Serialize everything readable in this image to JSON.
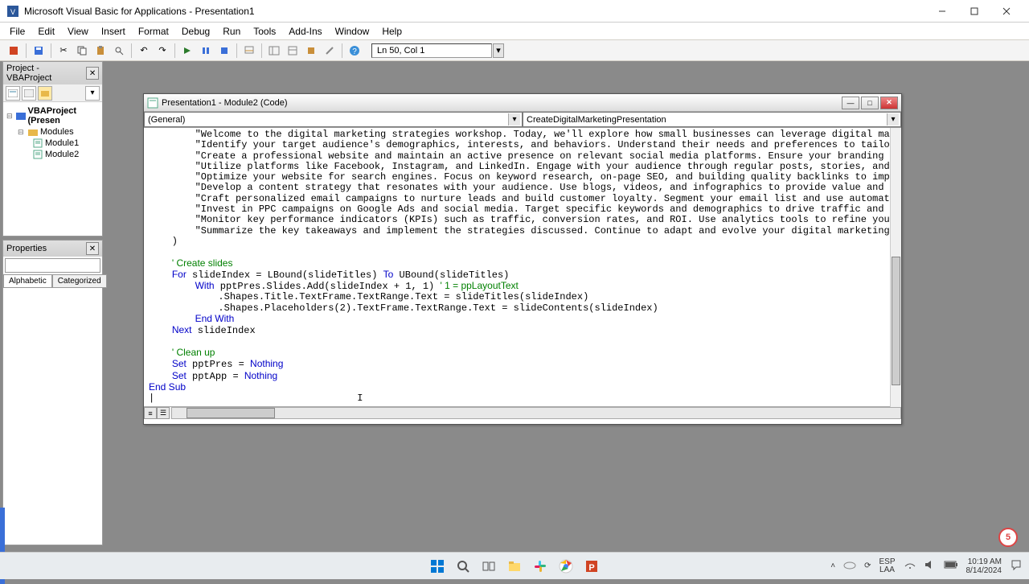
{
  "title": "Microsoft Visual Basic for Applications - Presentation1",
  "menu": [
    "File",
    "Edit",
    "View",
    "Insert",
    "Format",
    "Debug",
    "Run",
    "Tools",
    "Add-Ins",
    "Window",
    "Help"
  ],
  "linecol": "Ln 50, Col 1",
  "project": {
    "title": "Project - VBAProject",
    "root": "VBAProject (Presen",
    "modules_label": "Modules",
    "modules": [
      "Module1",
      "Module2"
    ]
  },
  "properties": {
    "title": "Properties",
    "tabs": [
      "Alphabetic",
      "Categorized"
    ]
  },
  "code_window": {
    "title": "Presentation1 - Module2 (Code)",
    "combo_left": "(General)",
    "combo_right": "CreateDigitalMarketingPresentation"
  },
  "code_lines": [
    {
      "indent": 8,
      "type": "str",
      "text": "\"Welcome to the digital marketing strategies workshop. Today, we'll explore how small businesses can leverage digital marketing"
    },
    {
      "indent": 8,
      "type": "str",
      "text": "\"Identify your target audience's demographics, interests, and behaviors. Understand their needs and preferences to tailor your"
    },
    {
      "indent": 8,
      "type": "str",
      "text": "\"Create a professional website and maintain an active presence on relevant social media platforms. Ensure your branding is cons"
    },
    {
      "indent": 8,
      "type": "str",
      "text": "\"Utilize platforms like Facebook, Instagram, and LinkedIn. Engage with your audience through regular posts, stories, and intera"
    },
    {
      "indent": 8,
      "type": "str",
      "text": "\"Optimize your website for search engines. Focus on keyword research, on-page SEO, and building quality backlinks to improve yo"
    },
    {
      "indent": 8,
      "type": "str",
      "text": "\"Develop a content strategy that resonates with your audience. Use blogs, videos, and infographics to provide value and drive e"
    },
    {
      "indent": 8,
      "type": "str",
      "text": "\"Craft personalized email campaigns to nurture leads and build customer loyalty. Segment your email list and use automation too"
    },
    {
      "indent": 8,
      "type": "str",
      "text": "\"Invest in PPC campaigns on Google Ads and social media. Target specific keywords and demographics to drive traffic and generat"
    },
    {
      "indent": 8,
      "type": "str",
      "text": "\"Monitor key performance indicators (KPIs) such as traffic, conversion rates, and ROI. Use analytics tools to refine your strat"
    },
    {
      "indent": 8,
      "type": "str",
      "text": "\"Summarize the key takeaways and implement the strategies discussed. Continue to adapt and evolve your digital marketing effort"
    },
    {
      "indent": 4,
      "type": "plain",
      "text": ")"
    },
    {
      "indent": 0,
      "type": "blank",
      "text": ""
    },
    {
      "indent": 4,
      "type": "comment",
      "text": "' Create slides"
    },
    {
      "indent": 4,
      "type": "code",
      "segments": [
        {
          "t": "For",
          "k": true
        },
        {
          "t": " slideIndex = "
        },
        {
          "t": "LBound",
          "k": false
        },
        {
          "t": "(slideTitles) "
        },
        {
          "t": "To",
          "k": true
        },
        {
          "t": " "
        },
        {
          "t": "UBound",
          "k": false
        },
        {
          "t": "(slideTitles)"
        }
      ]
    },
    {
      "indent": 8,
      "type": "code",
      "segments": [
        {
          "t": "With",
          "k": true
        },
        {
          "t": " pptPres.Slides.Add(slideIndex + 1, 1) "
        },
        {
          "t": "' 1 = ppLayoutText",
          "c": true
        }
      ]
    },
    {
      "indent": 12,
      "type": "plain",
      "text": ".Shapes.Title.TextFrame.TextRange.Text = slideTitles(slideIndex)"
    },
    {
      "indent": 12,
      "type": "plain",
      "text": ".Shapes.Placeholders(2).TextFrame.TextRange.Text = slideContents(slideIndex)"
    },
    {
      "indent": 8,
      "type": "code",
      "segments": [
        {
          "t": "End With",
          "k": true
        }
      ]
    },
    {
      "indent": 4,
      "type": "code",
      "segments": [
        {
          "t": "Next",
          "k": true
        },
        {
          "t": " slideIndex"
        }
      ]
    },
    {
      "indent": 0,
      "type": "blank",
      "text": ""
    },
    {
      "indent": 4,
      "type": "comment",
      "text": "' Clean up"
    },
    {
      "indent": 4,
      "type": "code",
      "segments": [
        {
          "t": "Set",
          "k": true
        },
        {
          "t": " pptPres = "
        },
        {
          "t": "Nothing",
          "k": true
        }
      ]
    },
    {
      "indent": 4,
      "type": "code",
      "segments": [
        {
          "t": "Set",
          "k": true
        },
        {
          "t": " pptApp = "
        },
        {
          "t": "Nothing",
          "k": true
        }
      ]
    },
    {
      "indent": 0,
      "type": "code",
      "segments": [
        {
          "t": "End Sub",
          "k": true
        }
      ]
    }
  ],
  "systray": {
    "lang1": "ESP",
    "lang2": "LAA",
    "time": "10:19 AM",
    "date": "8/14/2024",
    "badge": "5"
  }
}
